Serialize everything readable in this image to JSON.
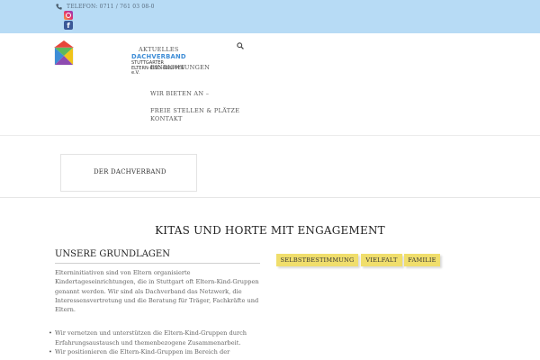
{
  "topbar": {
    "phone_text": "TELEFON: 0711 / 761 03 08-0",
    "instagram_icon": "instagram-icon",
    "facebook_icon": "facebook-icon",
    "facebook_glyph": "f"
  },
  "logo": {
    "line1": "DACHVERBAND",
    "line2": "STUTTGARTER",
    "line3": "ELTERN-KIND-GRUPPEN e.V."
  },
  "nav": {
    "items": [
      "AKTUELLES",
      "EINRICHTUNGEN",
      "WIR BIETEN AN –",
      "FREIE STELLEN & PLÄTZE",
      "KONTAKT"
    ],
    "search_icon": "search-icon"
  },
  "page": {
    "title_box": "DER DACHVERBAND",
    "headline": "KITAS UND HORTE MIT ENGAGEMENT",
    "section_title": "UNSERE GRUNDLAGEN",
    "paragraph": "Elterninitiativen sind von Eltern organisierte Kindertageseinrichtungen, die in Stuttgart oft Eltern-Kind-Gruppen genannt werden. Wir sind als Dachverband das Netzwerk, die Interessensvertretung und die Beratung für Träger, Fachkräfte und Eltern.",
    "bullets": [
      "Wir vernetzen und unterstützen die Eltern-Kind-Gruppen durch Erfahrungsaustausch und themenbezogene Zusammenarbeit.",
      "Wir positionieren die Eltern-Kind-Gruppen im Bereich der"
    ],
    "tags": [
      "SELBSTBESTIMMUNG",
      "VIELFALT",
      "FAMILIE"
    ]
  },
  "colors": {
    "topbar_bg": "#b7dbf5",
    "logo_blue": "#3d8cd6",
    "tag_bg": "#f0de6c"
  }
}
